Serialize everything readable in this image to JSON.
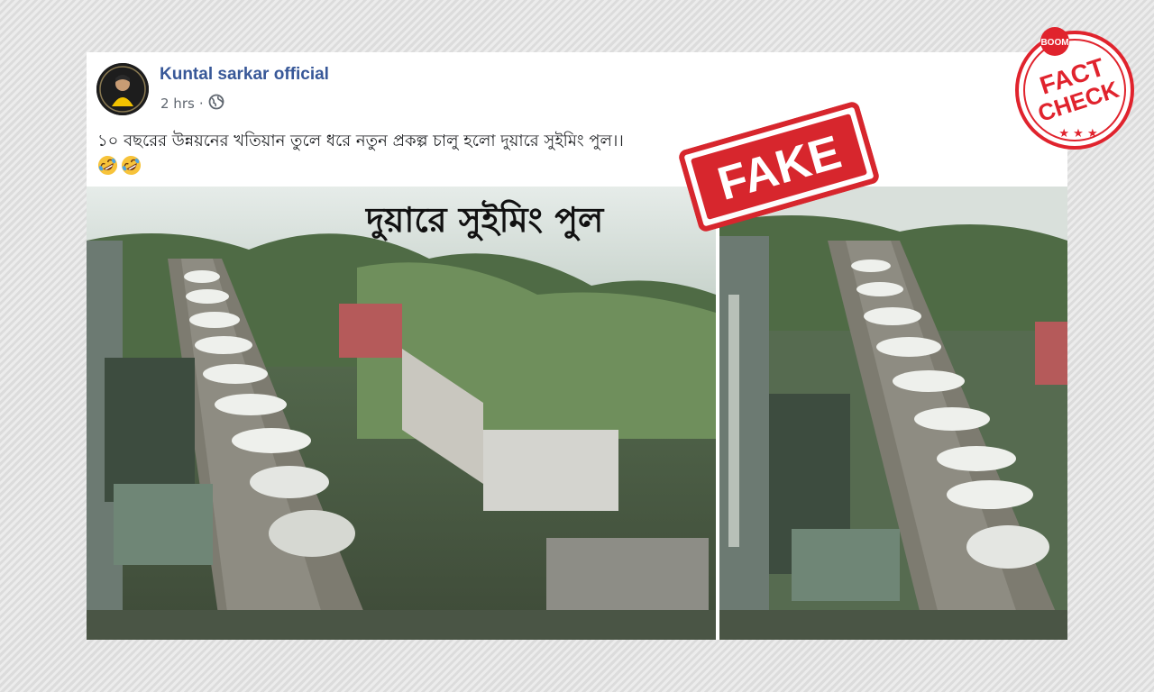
{
  "post": {
    "author": "Kuntal sarkar official",
    "timestamp": "2 hrs",
    "separator": "·",
    "audience_icon": "globe-icon",
    "text": "১০ বছরের উন্নয়নের খতিয়ান তুলে ধরে নতুন প্রকল্প চালু হলো দুয়ারে সুইমিং পুল।।",
    "emojis": [
      "rolling-on-floor-laughing-emoji",
      "rolling-on-floor-laughing-emoji"
    ]
  },
  "photo": {
    "caption": "দুয়ারে সুইমিং পুল"
  },
  "stamp": {
    "label": "FAKE",
    "color": "#d7262d"
  },
  "fact_check_logo": {
    "brand": "BOOM",
    "line1": "FACT",
    "line2": "CHECK",
    "color": "#e0232d"
  }
}
